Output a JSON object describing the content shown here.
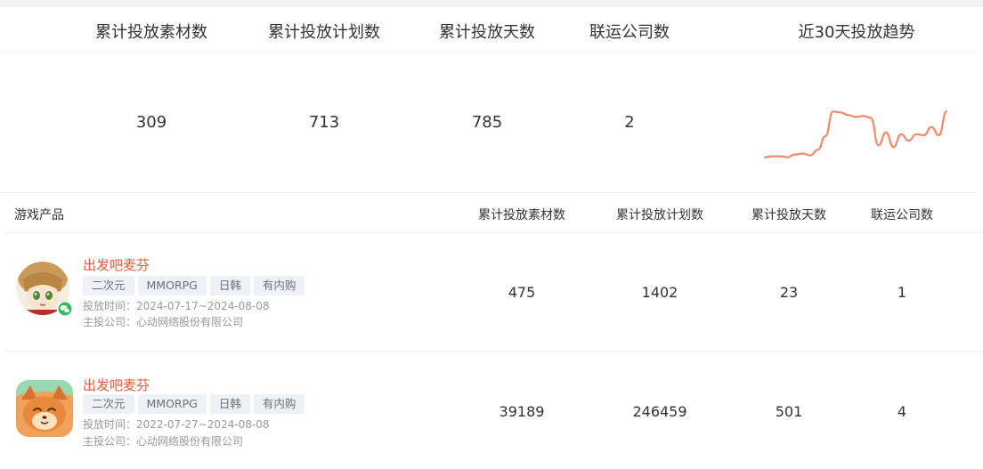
{
  "summary": {
    "headers": [
      "累计投放素材数",
      "累计投放计划数",
      "累计投放天数",
      "联运公司数",
      "近30天投放趋势"
    ],
    "values": [
      "309",
      "713",
      "785",
      "2"
    ],
    "trend": {
      "color": "#ef8a6d",
      "points": [
        12,
        13,
        13,
        12,
        15,
        16,
        14,
        20,
        35,
        62,
        61,
        58,
        56,
        57,
        55,
        25,
        39,
        23,
        37,
        30,
        37,
        36,
        45,
        36,
        62
      ]
    }
  },
  "table": {
    "headers": [
      "游戏产品",
      "累计投放素材数",
      "累计投放计划数",
      "累计投放天数",
      "联运公司数"
    ],
    "rows": [
      {
        "name": "出发吧麦芬",
        "tags": [
          "二次元",
          "MMORPG",
          "日韩",
          "有内购"
        ],
        "period": "投放时间：2024-07-17~2024-08-08",
        "company": "主投公司：心动网络股份有限公司",
        "materials": "475",
        "plans": "1402",
        "days": "23",
        "partners": "1",
        "icon": "wechat-icon"
      },
      {
        "name": "出发吧麦芬",
        "tags": [
          "二次元",
          "MMORPG",
          "日韩",
          "有内购"
        ],
        "period": "投放时间：2022-07-27~2024-08-08",
        "company": "主投公司：心动网络股份有限公司",
        "materials": "39189",
        "plans": "246459",
        "days": "501",
        "partners": "4"
      }
    ]
  },
  "colors": {
    "accent": "#e05a3a",
    "tag_bg": "#eef1f5",
    "muted": "#999999"
  }
}
